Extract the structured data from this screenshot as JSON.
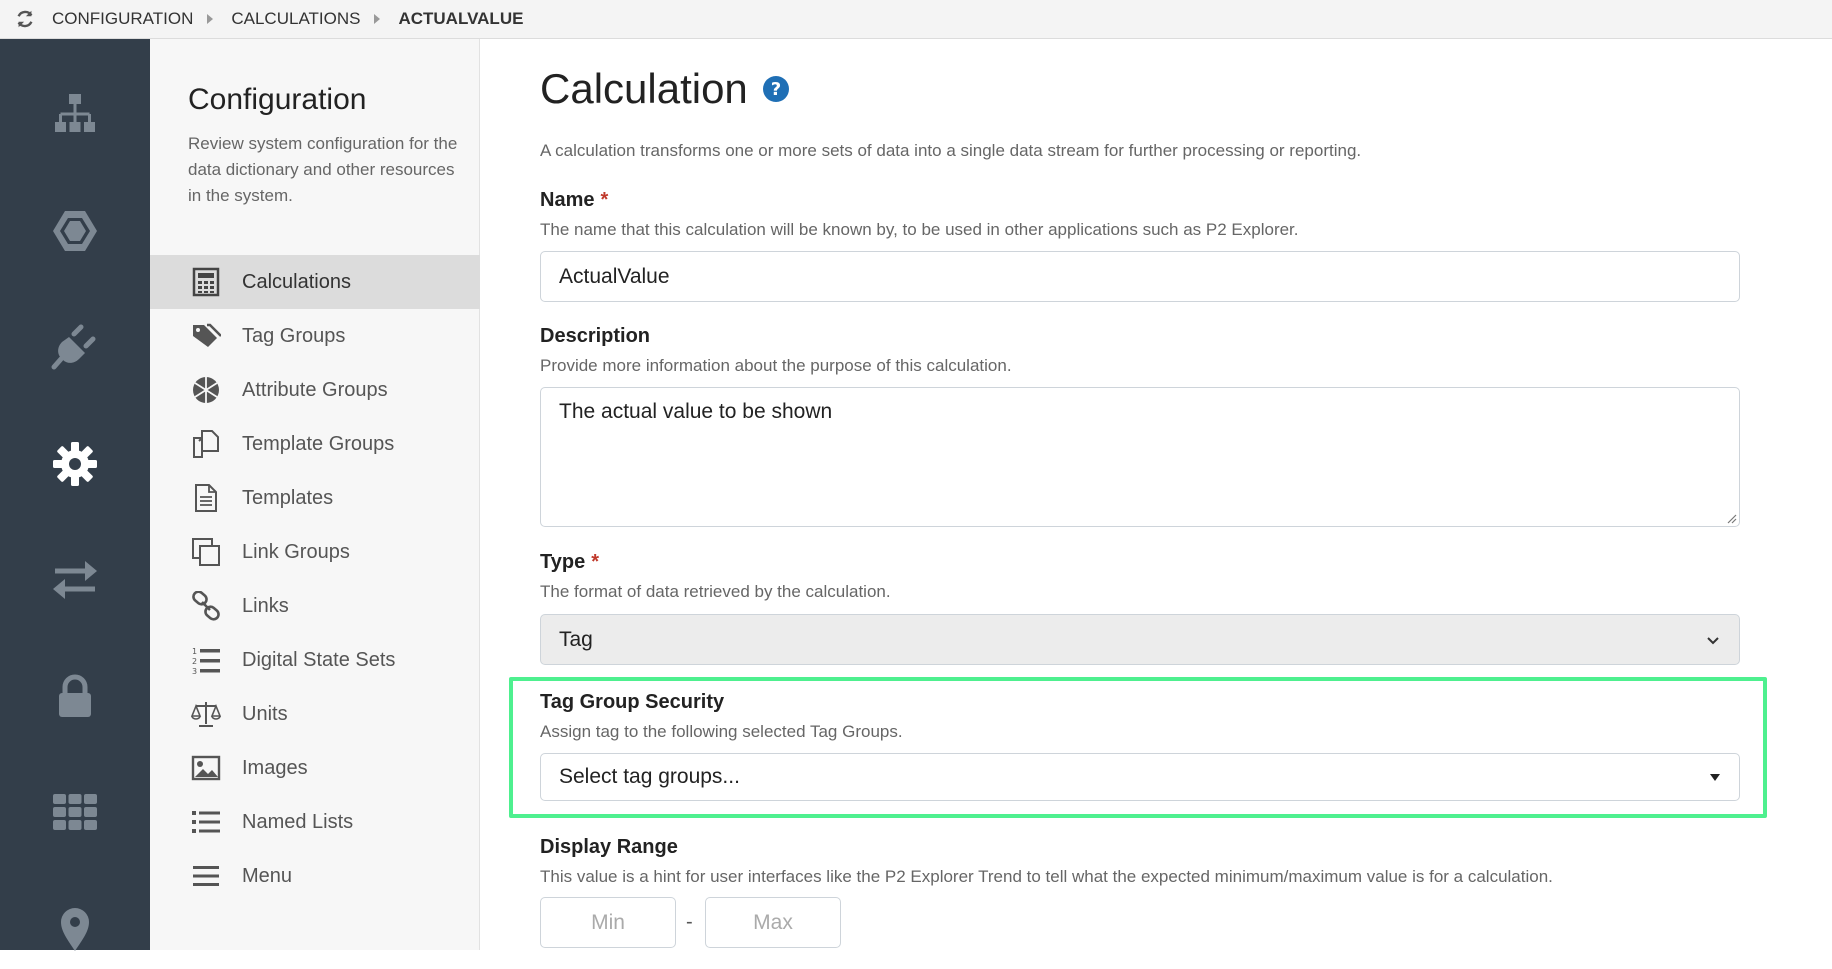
{
  "breadcrumb": {
    "items": [
      "CONFIGURATION",
      "CALCULATIONS",
      "ACTUALVALUE"
    ]
  },
  "rail": {
    "items": [
      "hierarchy-icon",
      "hexagon-icon",
      "plug-icon",
      "gear-icon",
      "transfer-icon",
      "lock-icon",
      "grid-icon",
      "location-pin-icon"
    ],
    "active": "gear-icon"
  },
  "sidebar": {
    "title": "Configuration",
    "intro": "Review system configuration for the data dictionary and other resources in the system.",
    "items": [
      {
        "label": "Calculations",
        "icon": "calculator-icon"
      },
      {
        "label": "Tag Groups",
        "icon": "tags-icon"
      },
      {
        "label": "Attribute Groups",
        "icon": "aperture-icon"
      },
      {
        "label": "Template Groups",
        "icon": "copy-files-icon"
      },
      {
        "label": "Templates",
        "icon": "document-icon"
      },
      {
        "label": "Link Groups",
        "icon": "clone-icon"
      },
      {
        "label": "Links",
        "icon": "link-icon"
      },
      {
        "label": "Digital State Sets",
        "icon": "ordered-list-icon"
      },
      {
        "label": "Units",
        "icon": "balance-scale-icon"
      },
      {
        "label": "Images",
        "icon": "image-icon"
      },
      {
        "label": "Named Lists",
        "icon": "list-icon"
      },
      {
        "label": "Menu",
        "icon": "menu-icon"
      }
    ],
    "active_index": 0
  },
  "main": {
    "title": "Calculation",
    "description": "A calculation transforms one or more sets of data into a single data stream for further processing or reporting.",
    "name": {
      "label": "Name",
      "required_mark": "*",
      "help": "The name that this calculation will be known by, to be used in other applications such as P2 Explorer.",
      "value": "ActualValue"
    },
    "desc_field": {
      "label": "Description",
      "help": "Provide more information about the purpose of this calculation.",
      "value": "The actual value to be shown"
    },
    "type": {
      "label": "Type",
      "required_mark": "*",
      "help": "The format of data retrieved by the calculation.",
      "value": "Tag"
    },
    "tag_group_security": {
      "label": "Tag Group Security",
      "help": "Assign tag to the following selected Tag Groups.",
      "placeholder": "Select tag groups..."
    },
    "display_range": {
      "label": "Display Range",
      "help": "This value is a hint for user interfaces like the P2 Explorer Trend to tell what the expected minimum/maximum value is for a calculation.",
      "min_placeholder": "Min",
      "separator": "-",
      "max_placeholder": "Max"
    }
  },
  "colors": {
    "rail_bg": "#333e4a",
    "highlight": "#4ef08f",
    "help_icon": "#1f6fb5",
    "required": "#c0392b"
  }
}
